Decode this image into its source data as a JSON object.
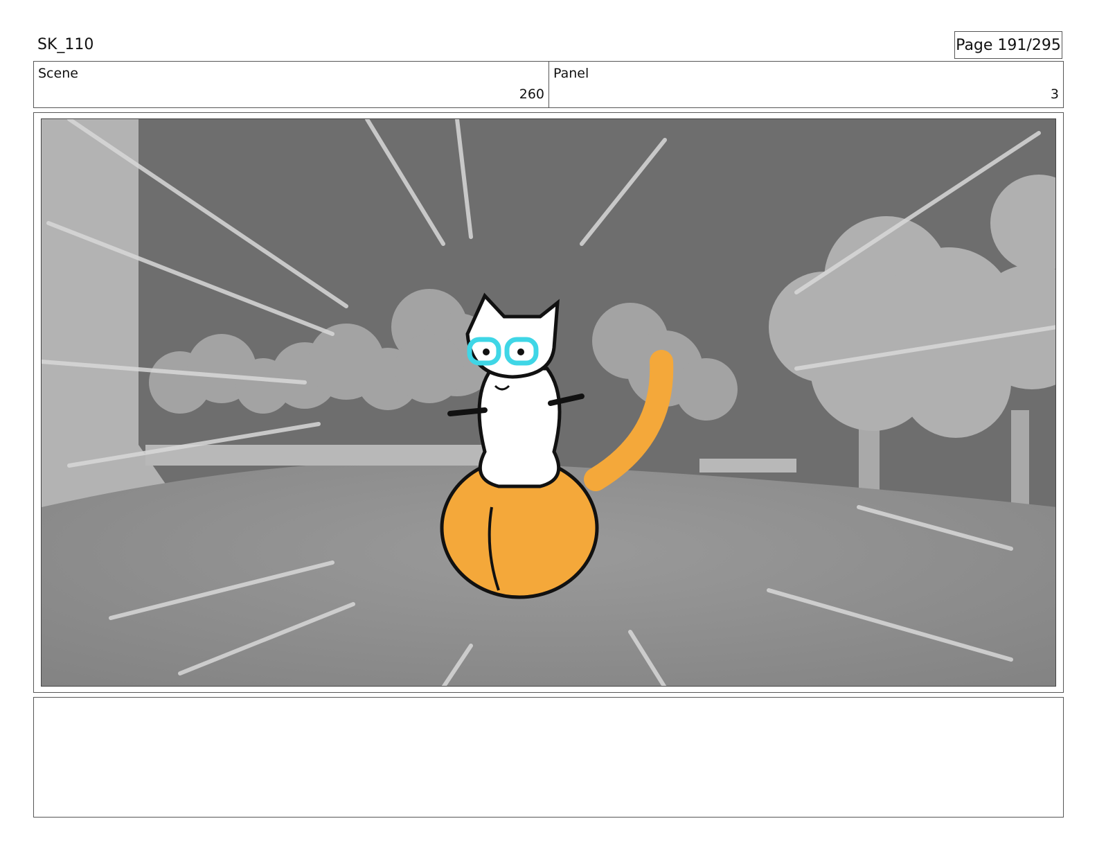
{
  "header": {
    "doc_id": "SK_110",
    "page_label": "Page 191/295"
  },
  "info": {
    "scene_label": "Scene",
    "scene_value": "260",
    "panel_label": "Panel",
    "panel_value": "3"
  },
  "colors": {
    "ball": "#f4a83a",
    "goggles": "#3fd6e6",
    "sky": "#6d6d6d",
    "ground": "#8e8e8e"
  },
  "notes": {
    "text": ""
  }
}
